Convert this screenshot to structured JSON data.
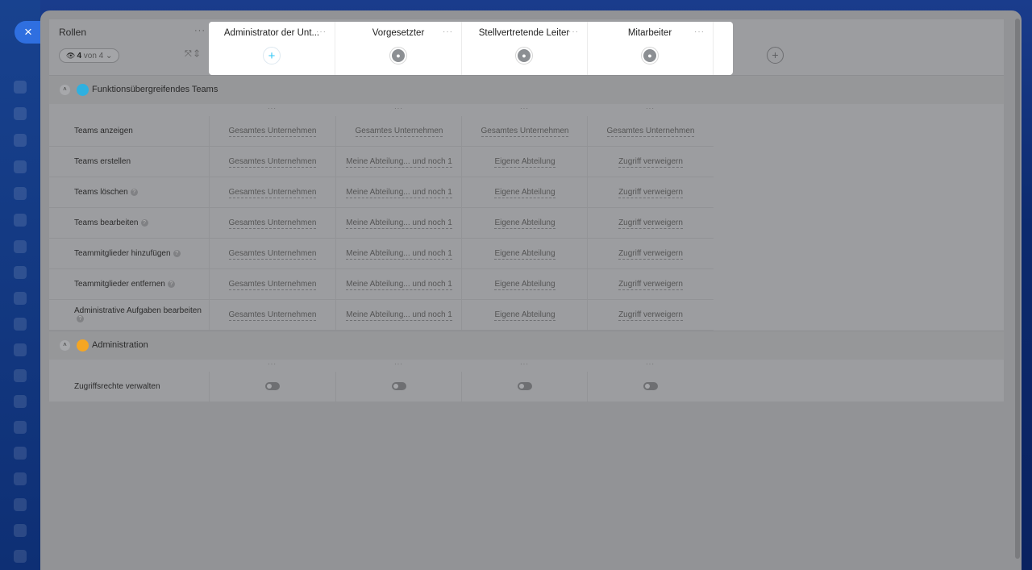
{
  "close_label": "×",
  "roles_header": {
    "title": "Rollen",
    "filter_count": "4",
    "filter_of": "von 4"
  },
  "columns": [
    {
      "name": "Administrator der Unt...",
      "icon": "plus-icon"
    },
    {
      "name": "Vorgesetzter",
      "icon": "users-icon"
    },
    {
      "name": "Stellvertretende Leiter",
      "icon": "users-icon"
    },
    {
      "name": "Mitarbeiter",
      "icon": "user-icon"
    }
  ],
  "sections": [
    {
      "title": "Funktionsübergreifendes Teams",
      "icon_color": "#2fb0e0",
      "rows": [
        {
          "name": "Teams anzeigen",
          "help": false,
          "values": [
            "Gesamtes Unternehmen",
            "Gesamtes Unternehmen",
            "Gesamtes Unternehmen",
            "Gesamtes Unternehmen"
          ]
        },
        {
          "name": "Teams erstellen",
          "help": false,
          "values": [
            "Gesamtes Unternehmen",
            "Meine Abteilung... und noch 1",
            "Eigene Abteilung",
            "Zugriff verweigern"
          ]
        },
        {
          "name": "Teams löschen",
          "help": true,
          "values": [
            "Gesamtes Unternehmen",
            "Meine Abteilung... und noch 1",
            "Eigene Abteilung",
            "Zugriff verweigern"
          ]
        },
        {
          "name": "Teams bearbeiten",
          "help": true,
          "values": [
            "Gesamtes Unternehmen",
            "Meine Abteilung... und noch 1",
            "Eigene Abteilung",
            "Zugriff verweigern"
          ]
        },
        {
          "name": "Teammitglieder hinzufügen",
          "help": true,
          "values": [
            "Gesamtes Unternehmen",
            "Meine Abteilung... und noch 1",
            "Eigene Abteilung",
            "Zugriff verweigern"
          ]
        },
        {
          "name": "Teammitglieder entfernen",
          "help": true,
          "values": [
            "Gesamtes Unternehmen",
            "Meine Abteilung... und noch 1",
            "Eigene Abteilung",
            "Zugriff verweigern"
          ]
        },
        {
          "name": "Administrative Aufgaben bearbeiten",
          "help": true,
          "values": [
            "Gesamtes Unternehmen",
            "Meine Abteilung... und noch 1",
            "Eigene Abteilung",
            "Zugriff verweigern"
          ]
        }
      ]
    },
    {
      "title": "Administration",
      "icon_color": "#f5a623",
      "rows": [
        {
          "name": "Zugriffsrechte verwalten",
          "help": false,
          "toggles": [
            false,
            false,
            false,
            false
          ]
        }
      ]
    }
  ],
  "colors": {
    "accent": "#2fc6f6",
    "close_button": "#2f6fe0"
  }
}
